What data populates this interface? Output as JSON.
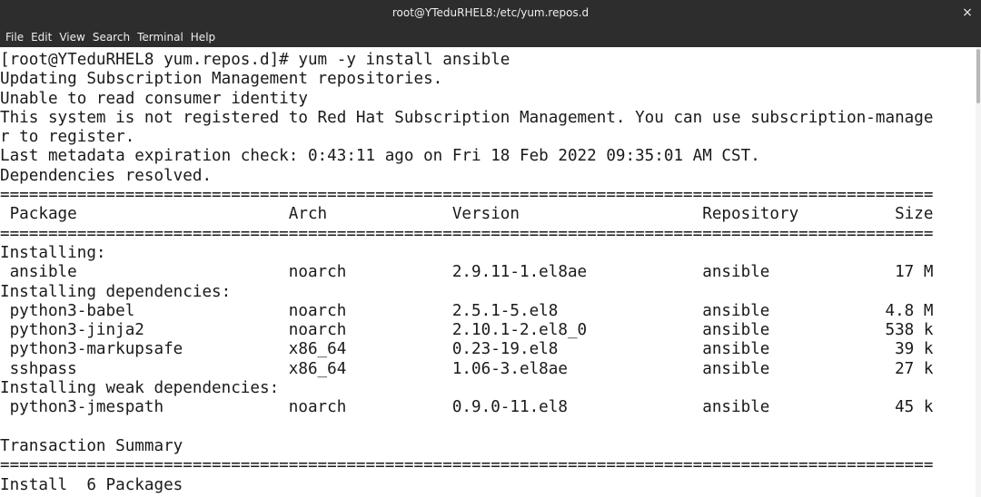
{
  "window": {
    "title": "root@YTeduRHEL8:/etc/yum.repos.d",
    "close_glyph": "×"
  },
  "menu": {
    "items": [
      "File",
      "Edit",
      "View",
      "Search",
      "Terminal",
      "Help"
    ]
  },
  "terminal": {
    "lines": [
      "[root@YTeduRHEL8 yum.repos.d]# yum -y install ansible",
      "Updating Subscription Management repositories.",
      "Unable to read consumer identity",
      "This system is not registered to Red Hat Subscription Management. You can use subscription-manage",
      "r to register.",
      "Last metadata expiration check: 0:43:11 ago on Fri 18 Feb 2022 09:35:01 AM CST.",
      "Dependencies resolved.",
      "=================================================================================================",
      " Package                      Arch             Version                   Repository          Size",
      "=================================================================================================",
      "Installing:",
      " ansible                      noarch           2.9.11-1.el8ae            ansible             17 M",
      "Installing dependencies:",
      " python3-babel                noarch           2.5.1-5.el8               ansible            4.8 M",
      " python3-jinja2               noarch           2.10.1-2.el8_0            ansible            538 k",
      " python3-markupsafe           x86_64           0.23-19.el8               ansible             39 k",
      " sshpass                      x86_64           1.06-3.el8ae              ansible             27 k",
      "Installing weak dependencies:",
      " python3-jmespath             noarch           0.9.0-11.el8              ansible             45 k",
      "",
      "Transaction Summary",
      "=================================================================================================",
      "Install  6 Packages"
    ]
  },
  "colors": {
    "titlebar_bg": "#2d2d2d",
    "titlebar_fg": "#eeeeec",
    "terminal_bg": "#ffffff",
    "terminal_fg": "#1a1a1a"
  }
}
